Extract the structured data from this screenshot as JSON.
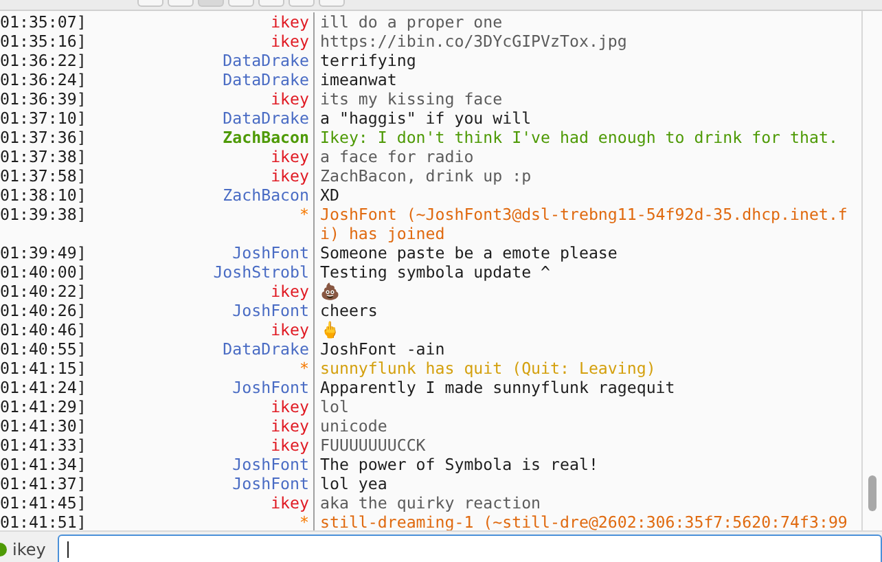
{
  "toolbar": {
    "buttons": [
      {
        "selected": false
      },
      {
        "selected": false
      },
      {
        "selected": true
      },
      {
        "selected": false
      },
      {
        "selected": false
      },
      {
        "selected": false
      },
      {
        "selected": false
      }
    ]
  },
  "log": [
    {
      "time": "01:35:07]",
      "nick": "ikey",
      "color": "#e01b24",
      "kind": "own",
      "text": "ill do a proper one"
    },
    {
      "time": "01:35:16]",
      "nick": "ikey",
      "color": "#e01b24",
      "kind": "own",
      "text": "https://ibin.co/3DYcGIPVzTox.jpg"
    },
    {
      "time": "01:36:22]",
      "nick": "DataDrake",
      "color": "#4a6cc4",
      "kind": "message",
      "text": "terrifying"
    },
    {
      "time": "01:36:24]",
      "nick": "DataDrake",
      "color": "#4a6cc4",
      "kind": "message",
      "text": "imeanwat"
    },
    {
      "time": "01:36:39]",
      "nick": "ikey",
      "color": "#e01b24",
      "kind": "own",
      "text": "its my kissing face"
    },
    {
      "time": "01:37:10]",
      "nick": "DataDrake",
      "color": "#4a6cc4",
      "kind": "message",
      "text": "a \"haggis\" if you will"
    },
    {
      "time": "01:37:36]",
      "nick": "ZachBacon",
      "color": "#4e9a06",
      "kind": "highlight",
      "text": "Ikey: I don't think I've had enough to drink for that."
    },
    {
      "time": "01:37:38]",
      "nick": "ikey",
      "color": "#e01b24",
      "kind": "own",
      "text": "a face for radio"
    },
    {
      "time": "01:37:58]",
      "nick": "ikey",
      "color": "#e01b24",
      "kind": "own",
      "text": "ZachBacon, drink up :p"
    },
    {
      "time": "01:38:10]",
      "nick": "ZachBacon",
      "color": "#4a6cc4",
      "kind": "message",
      "text": "XD"
    },
    {
      "time": "01:39:38]",
      "nick": "*",
      "color": "#f57900",
      "kind": "join",
      "text": "JoshFont (~JoshFont3@dsl-trebng11-54f92d-35.dhcp.inet.fi) has joined"
    },
    {
      "time": "01:39:49]",
      "nick": "JoshFont",
      "color": "#4a6cc4",
      "kind": "message",
      "text": "Someone paste be a emote please"
    },
    {
      "time": "01:40:00]",
      "nick": "JoshStrobl",
      "color": "#4a6cc4",
      "kind": "message",
      "text": "Testing symbola update ^"
    },
    {
      "time": "01:40:22]",
      "nick": "ikey",
      "color": "#e01b24",
      "kind": "own",
      "text": "💩"
    },
    {
      "time": "01:40:26]",
      "nick": "JoshFont",
      "color": "#4a6cc4",
      "kind": "message",
      "text": "cheers"
    },
    {
      "time": "01:40:46]",
      "nick": "ikey",
      "color": "#e01b24",
      "kind": "own",
      "text": "🖕"
    },
    {
      "time": "01:40:55]",
      "nick": "DataDrake",
      "color": "#4a6cc4",
      "kind": "message",
      "text": "JoshFont -ain"
    },
    {
      "time": "01:41:15]",
      "nick": "*",
      "color": "#f57900",
      "kind": "quit",
      "text": "sunnyflunk has quit (Quit: Leaving)"
    },
    {
      "time": "01:41:24]",
      "nick": "JoshFont",
      "color": "#4a6cc4",
      "kind": "message",
      "text": "Apparently I made sunnyflunk ragequit"
    },
    {
      "time": "01:41:29]",
      "nick": "ikey",
      "color": "#e01b24",
      "kind": "own",
      "text": "lol"
    },
    {
      "time": "01:41:30]",
      "nick": "ikey",
      "color": "#e01b24",
      "kind": "own",
      "text": "unicode"
    },
    {
      "time": "01:41:33]",
      "nick": "ikey",
      "color": "#e01b24",
      "kind": "own",
      "text": "FUUUUUUUCCK"
    },
    {
      "time": "01:41:34]",
      "nick": "JoshFont",
      "color": "#4a6cc4",
      "kind": "message",
      "text": "The power of Symbola is real!"
    },
    {
      "time": "01:41:37]",
      "nick": "JoshFont",
      "color": "#4a6cc4",
      "kind": "message",
      "text": "lol yea"
    },
    {
      "time": "01:41:45]",
      "nick": "ikey",
      "color": "#e01b24",
      "kind": "own",
      "text": "aka the quirky reaction"
    },
    {
      "time": "01:41:51]",
      "nick": "*",
      "color": "#f57900",
      "kind": "join",
      "text": "still-dreaming-1 (~still-dre@2602:306:35f7:5620:74f3:99"
    }
  ],
  "input": {
    "nick": "ikey",
    "online": true
  }
}
